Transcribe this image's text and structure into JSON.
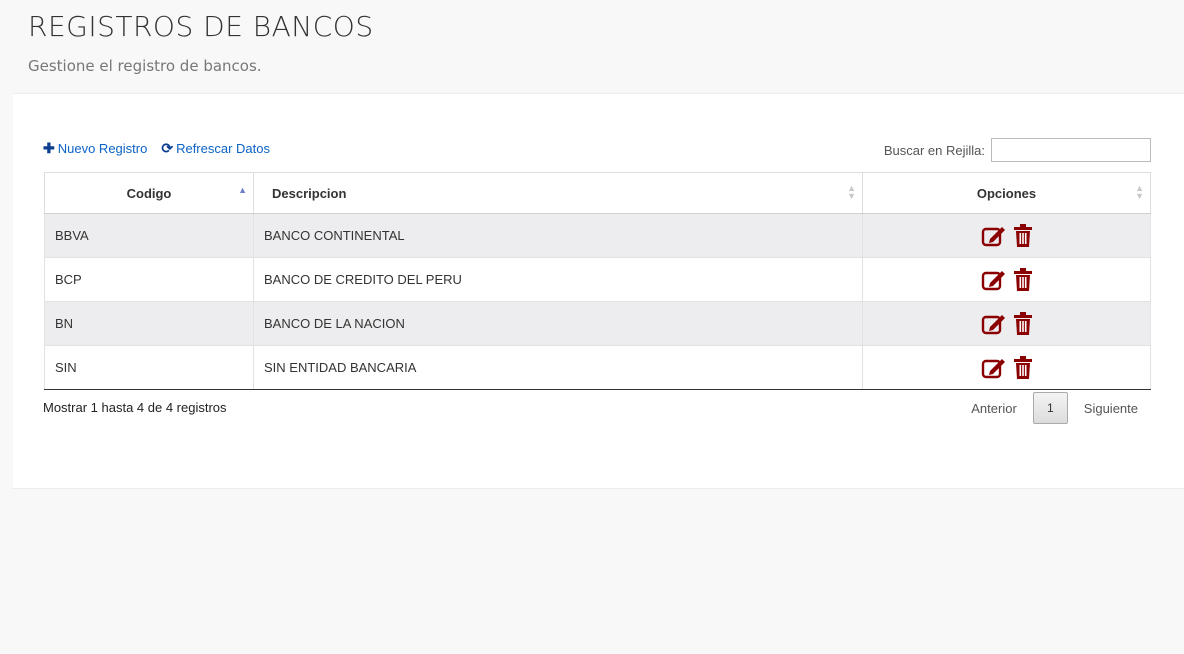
{
  "header": {
    "title": "REGISTROS DE BANCOS",
    "subtitle": "Gestione el registro de bancos."
  },
  "toolbar": {
    "new_label": "Nuevo Registro",
    "refresh_label": "Refrescar Datos"
  },
  "search": {
    "label": "Buscar en Rejilla:",
    "value": ""
  },
  "table": {
    "columns": [
      "Codigo",
      "Descripcion",
      "Opciones"
    ],
    "rows": [
      {
        "codigo": "BBVA",
        "descripcion": "BANCO CONTINENTAL"
      },
      {
        "codigo": "BCP",
        "descripcion": "BANCO DE CREDITO DEL PERU"
      },
      {
        "codigo": "BN",
        "descripcion": "BANCO DE LA NACION"
      },
      {
        "codigo": "SIN",
        "descripcion": "SIN ENTIDAD BANCARIA"
      }
    ]
  },
  "footer": {
    "info": "Mostrar 1 hasta 4 de 4 registros",
    "prev_label": "Anterior",
    "current_page": "1",
    "next_label": "Siguiente"
  },
  "colors": {
    "link": "#0b63c6",
    "action_icon": "#8b0000"
  },
  "icons": {
    "new": "plus-icon",
    "refresh": "refresh-icon",
    "edit": "edit-icon",
    "delete": "trash-icon"
  }
}
